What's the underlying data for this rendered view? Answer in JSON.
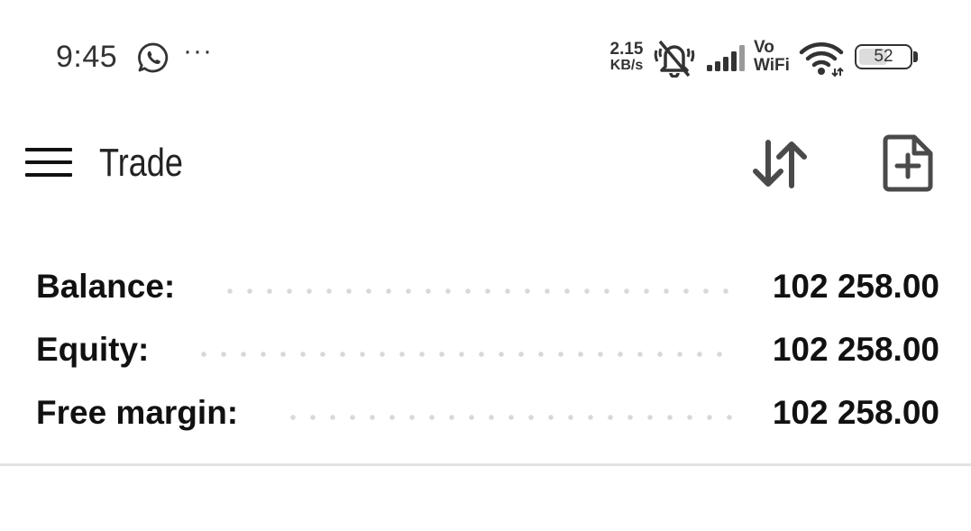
{
  "status_bar": {
    "time": "9:45",
    "more": "···",
    "net_speed_value": "2.15",
    "net_speed_unit": "KB/s",
    "vowifi_top": "Vo",
    "vowifi_bottom": "WiFi",
    "battery_level": "52",
    "icons": [
      "whatsapp-icon",
      "bell-off-icon",
      "cell-signal-icon",
      "wifi-icon",
      "battery-icon"
    ]
  },
  "app_bar": {
    "title": "Trade",
    "icons": [
      "hamburger-menu-icon",
      "sort-arrows-icon",
      "new-order-file-plus-icon"
    ]
  },
  "account": {
    "rows": [
      {
        "label": "Balance:",
        "value": "102 258.00"
      },
      {
        "label": "Equity:",
        "value": "102 258.00"
      },
      {
        "label": "Free margin:",
        "value": "102 258.00"
      }
    ]
  },
  "colors": {
    "background": "#ffffff",
    "text": "#111111",
    "icon": "#4a4a4a",
    "divider": "#e2e2e2",
    "leader_dots": "#d8d8d8"
  }
}
